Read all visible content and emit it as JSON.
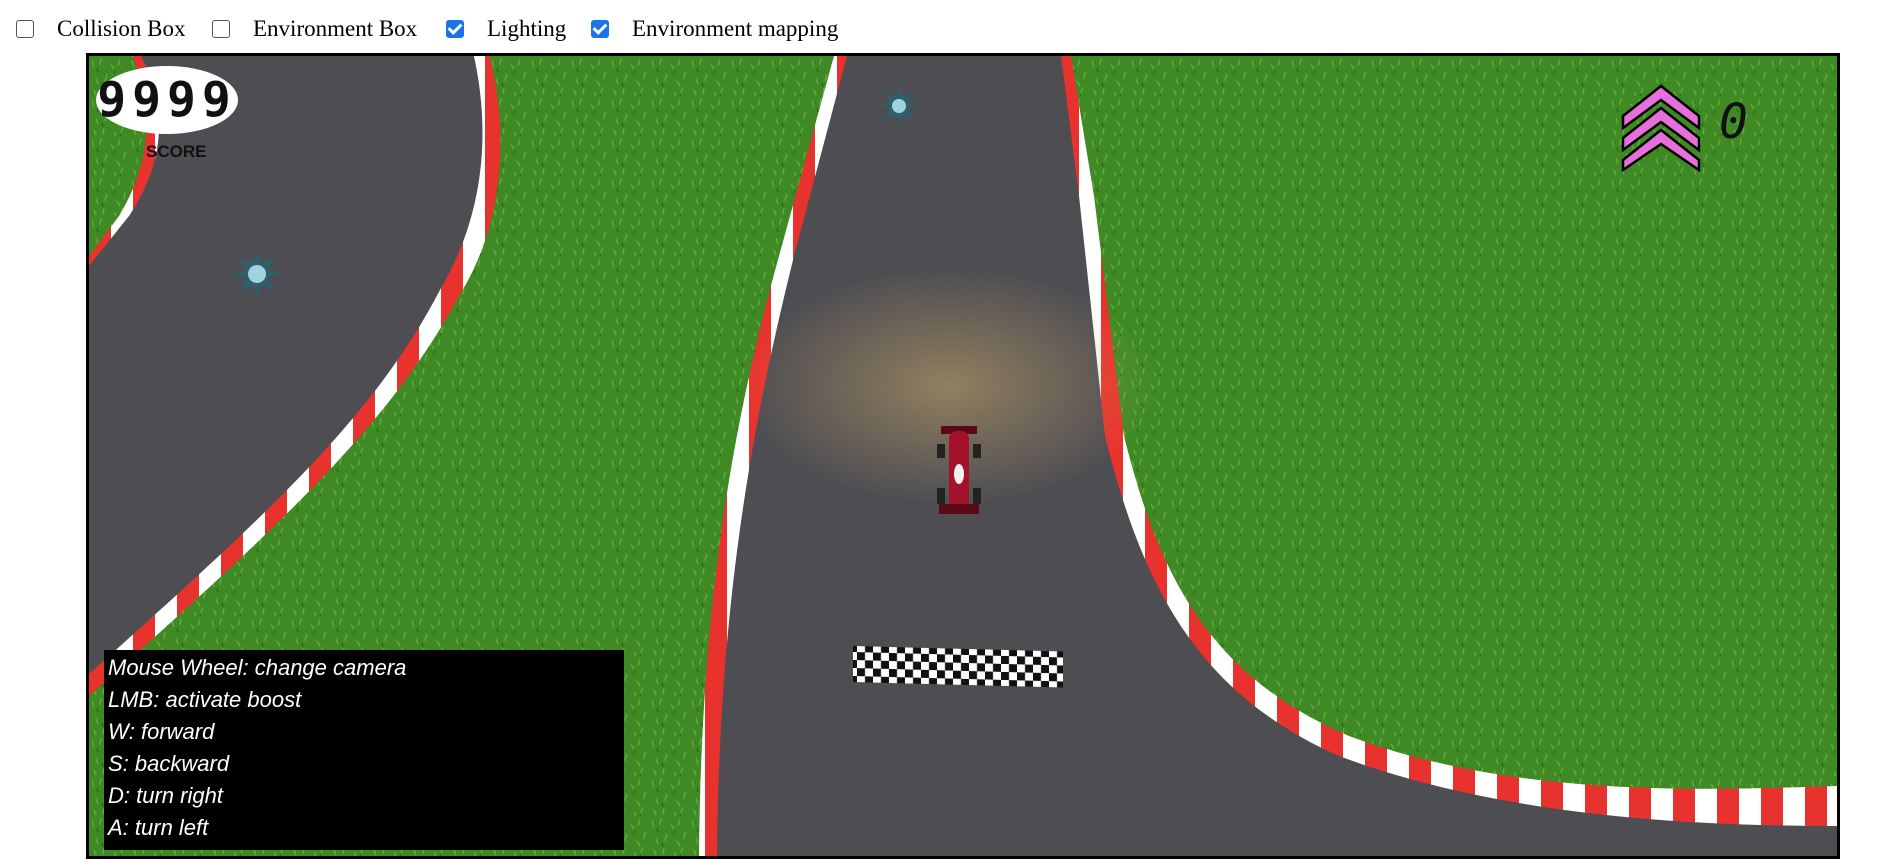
{
  "toolbar": {
    "options": [
      {
        "label": "Collision Box",
        "checked": false
      },
      {
        "label": "Environment Box",
        "checked": false
      },
      {
        "label": "Lighting",
        "checked": true
      },
      {
        "label": "Environment mapping",
        "checked": true
      }
    ]
  },
  "hud": {
    "score_value": "9999",
    "score_label": "SCORE",
    "boost_count": "0"
  },
  "controls": [
    "Mouse Wheel: change camera",
    "LMB: activate boost",
    "W: forward",
    "S: backward",
    "D: turn right",
    "A: turn left"
  ],
  "colors": {
    "grass": "#3f8a25",
    "track": "#4d4d52",
    "curb_red": "#e8322d",
    "curb_white": "#ffffff",
    "boost_pink": "#e66fd9",
    "car_red": "#a3122a"
  }
}
